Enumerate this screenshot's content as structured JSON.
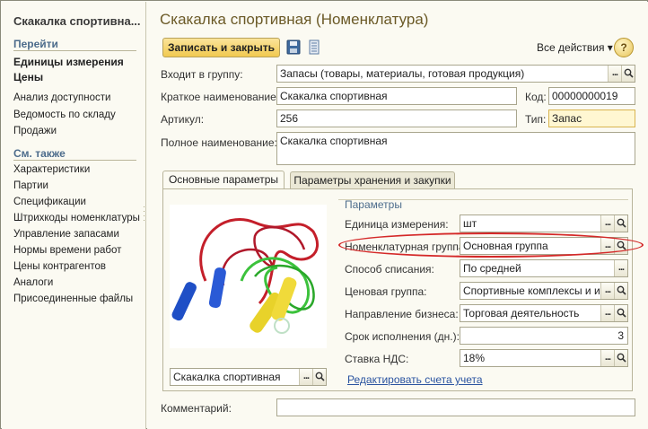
{
  "left": {
    "title": "Скакалка спортивна...",
    "section_goto": "Перейти",
    "goto_items": [
      "Единицы измерения",
      "Цены"
    ],
    "reports": [
      "Анализ доступности",
      "Ведомость по складу",
      "Продажи"
    ],
    "section_see_also": "См. также",
    "see_also": [
      "Характеристики",
      "Партии",
      "Спецификации",
      "Штрихкоды номенклатуры",
      "Управление запасами",
      "Нормы времени работ",
      "Цены контрагентов",
      "Аналоги",
      "Присоединенные файлы"
    ]
  },
  "main": {
    "title": "Скакалка спортивная (Номенклатура)",
    "save_close": "Записать и закрыть",
    "all_actions": "Все действия ▾",
    "help": "?",
    "group_label": "Входит в группу:",
    "group_value": "Запасы (товары, материалы, готовая продукция)",
    "short_name_label": "Краткое наименование:",
    "short_name_value": "Скакалка спортивная",
    "code_label": "Код:",
    "code_value": "00000000019",
    "article_label": "Артикул:",
    "article_value": "256",
    "type_label": "Тип:",
    "type_value": "Запас",
    "full_name_label": "Полное наименование:",
    "full_name_value": "Скакалка спортивная",
    "comment_label": "Комментарий:",
    "comment_value": ""
  },
  "tabs": [
    "Основные параметры",
    "Параметры хранения и закупки"
  ],
  "image_caption": "Скакалка спортивная",
  "params": {
    "title": "Параметры",
    "unit_label": "Единица измерения:",
    "unit_value": "шт",
    "nom_group_label": "Номенклатурная группа:",
    "nom_group_value": "Основная группа",
    "writeoff_label": "Способ списания:",
    "writeoff_value": "По средней",
    "price_group_label": "Ценовая группа:",
    "price_group_value": "Спортивные комплексы и инв",
    "business_label": "Направление бизнеса:",
    "business_value": "Торговая деятельность",
    "term_label": "Срок исполнения (дн.):",
    "term_value": "3",
    "vat_label": "Ставка НДС:",
    "vat_value": "18%",
    "edit_link": "Редактировать счета учета"
  },
  "colors": {
    "accent_title": "#6b5a27",
    "section": "#4d6c8c",
    "save_button": "#f1c950",
    "highlight_circle": "#d42828",
    "link": "#2a53a0"
  },
  "icons": [
    "save-icon",
    "list-icon",
    "help-icon",
    "select-dots-icon",
    "search-icon"
  ]
}
